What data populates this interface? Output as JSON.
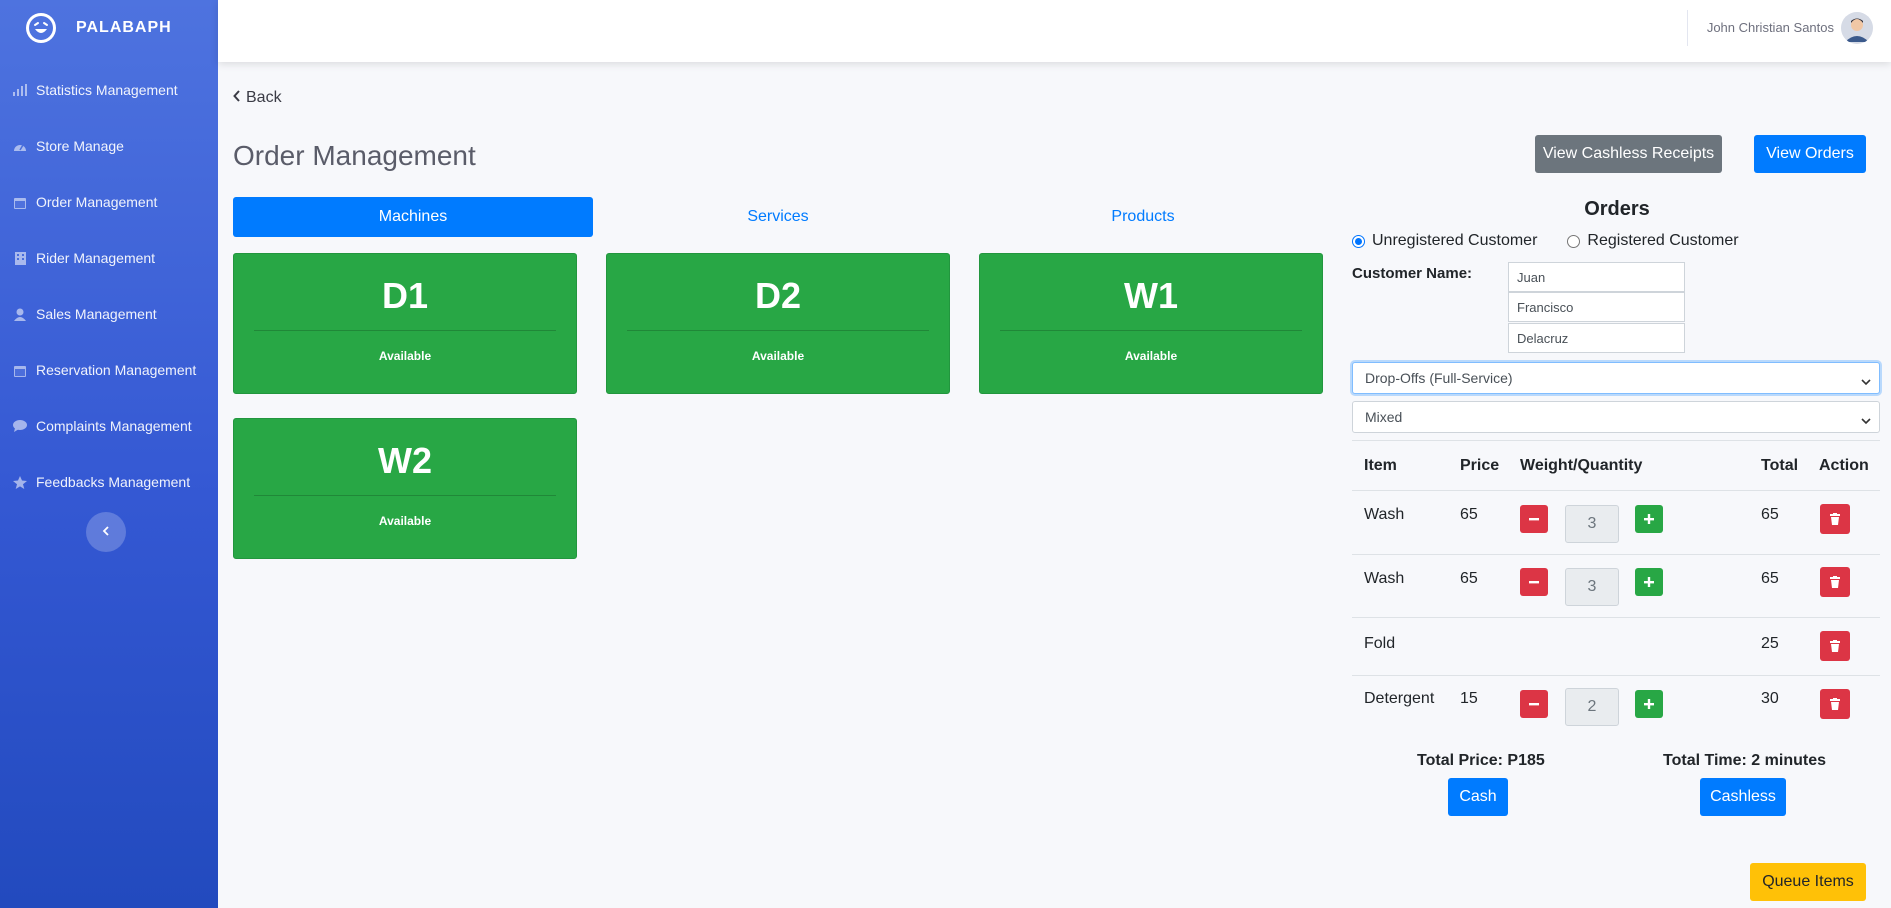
{
  "brand": {
    "name": "PALABAPH"
  },
  "sidebar": {
    "items": [
      {
        "label": "Statistics Management",
        "icon": "bar-chart-icon"
      },
      {
        "label": "Store Manage",
        "icon": "gauge-icon"
      },
      {
        "label": "Order Management",
        "icon": "calendar-icon"
      },
      {
        "label": "Rider Management",
        "icon": "building-icon"
      },
      {
        "label": "Sales Management",
        "icon": "user-icon"
      },
      {
        "label": "Reservation Management",
        "icon": "calendar-icon"
      },
      {
        "label": "Complaints Management",
        "icon": "comment-icon"
      },
      {
        "label": "Feedbacks Management",
        "icon": "star-icon"
      }
    ]
  },
  "topbar": {
    "user_name": "John Christian Santos"
  },
  "main": {
    "back_label": "Back",
    "title": "Order Management",
    "view_cashless_label": "View Cashless Receipts",
    "view_orders_label": "View Orders",
    "tabs": [
      {
        "label": "Machines",
        "active": true
      },
      {
        "label": "Services",
        "active": false
      },
      {
        "label": "Products",
        "active": false
      }
    ],
    "machines": [
      {
        "name": "D1",
        "status": "Available"
      },
      {
        "name": "D2",
        "status": "Available"
      },
      {
        "name": "W1",
        "status": "Available"
      },
      {
        "name": "W2",
        "status": "Available"
      }
    ]
  },
  "orders": {
    "title": "Orders",
    "customer_types": [
      {
        "label": "Unregistered Customer",
        "checked": true
      },
      {
        "label": "Registered Customer",
        "checked": false
      }
    ],
    "customer_name_label": "Customer Name:",
    "first_name": "Juan",
    "middle_name": "Francisco",
    "last_name": "Delacruz",
    "service_type": "Drop-Offs (Full-Service)",
    "load_type": "Mixed",
    "columns": {
      "item": "Item",
      "price": "Price",
      "weight_quantity": "Weight/Quantity",
      "total": "Total",
      "action": "Action"
    },
    "rows": [
      {
        "item": "Wash",
        "price": "65",
        "quantity": "3",
        "total": "65"
      },
      {
        "item": "Wash",
        "price": "65",
        "quantity": "3",
        "total": "65"
      },
      {
        "item": "Fold",
        "price": "",
        "quantity": "",
        "total": "25"
      },
      {
        "item": "Detergent",
        "price": "15",
        "quantity": "2",
        "total": "30"
      }
    ],
    "total_price": "Total Price: P185",
    "total_time": "Total Time: 2 minutes",
    "cash_label": "Cash",
    "cashless_label": "Cashless",
    "queue_label": "Queue Items"
  },
  "colors": {
    "sidebar_top": "#4e73df",
    "sidebar_bottom": "#224abe",
    "primary": "#007bff",
    "success": "#28a745",
    "danger": "#dc3545",
    "secondary": "#6c757d",
    "warning": "#ffc107"
  }
}
